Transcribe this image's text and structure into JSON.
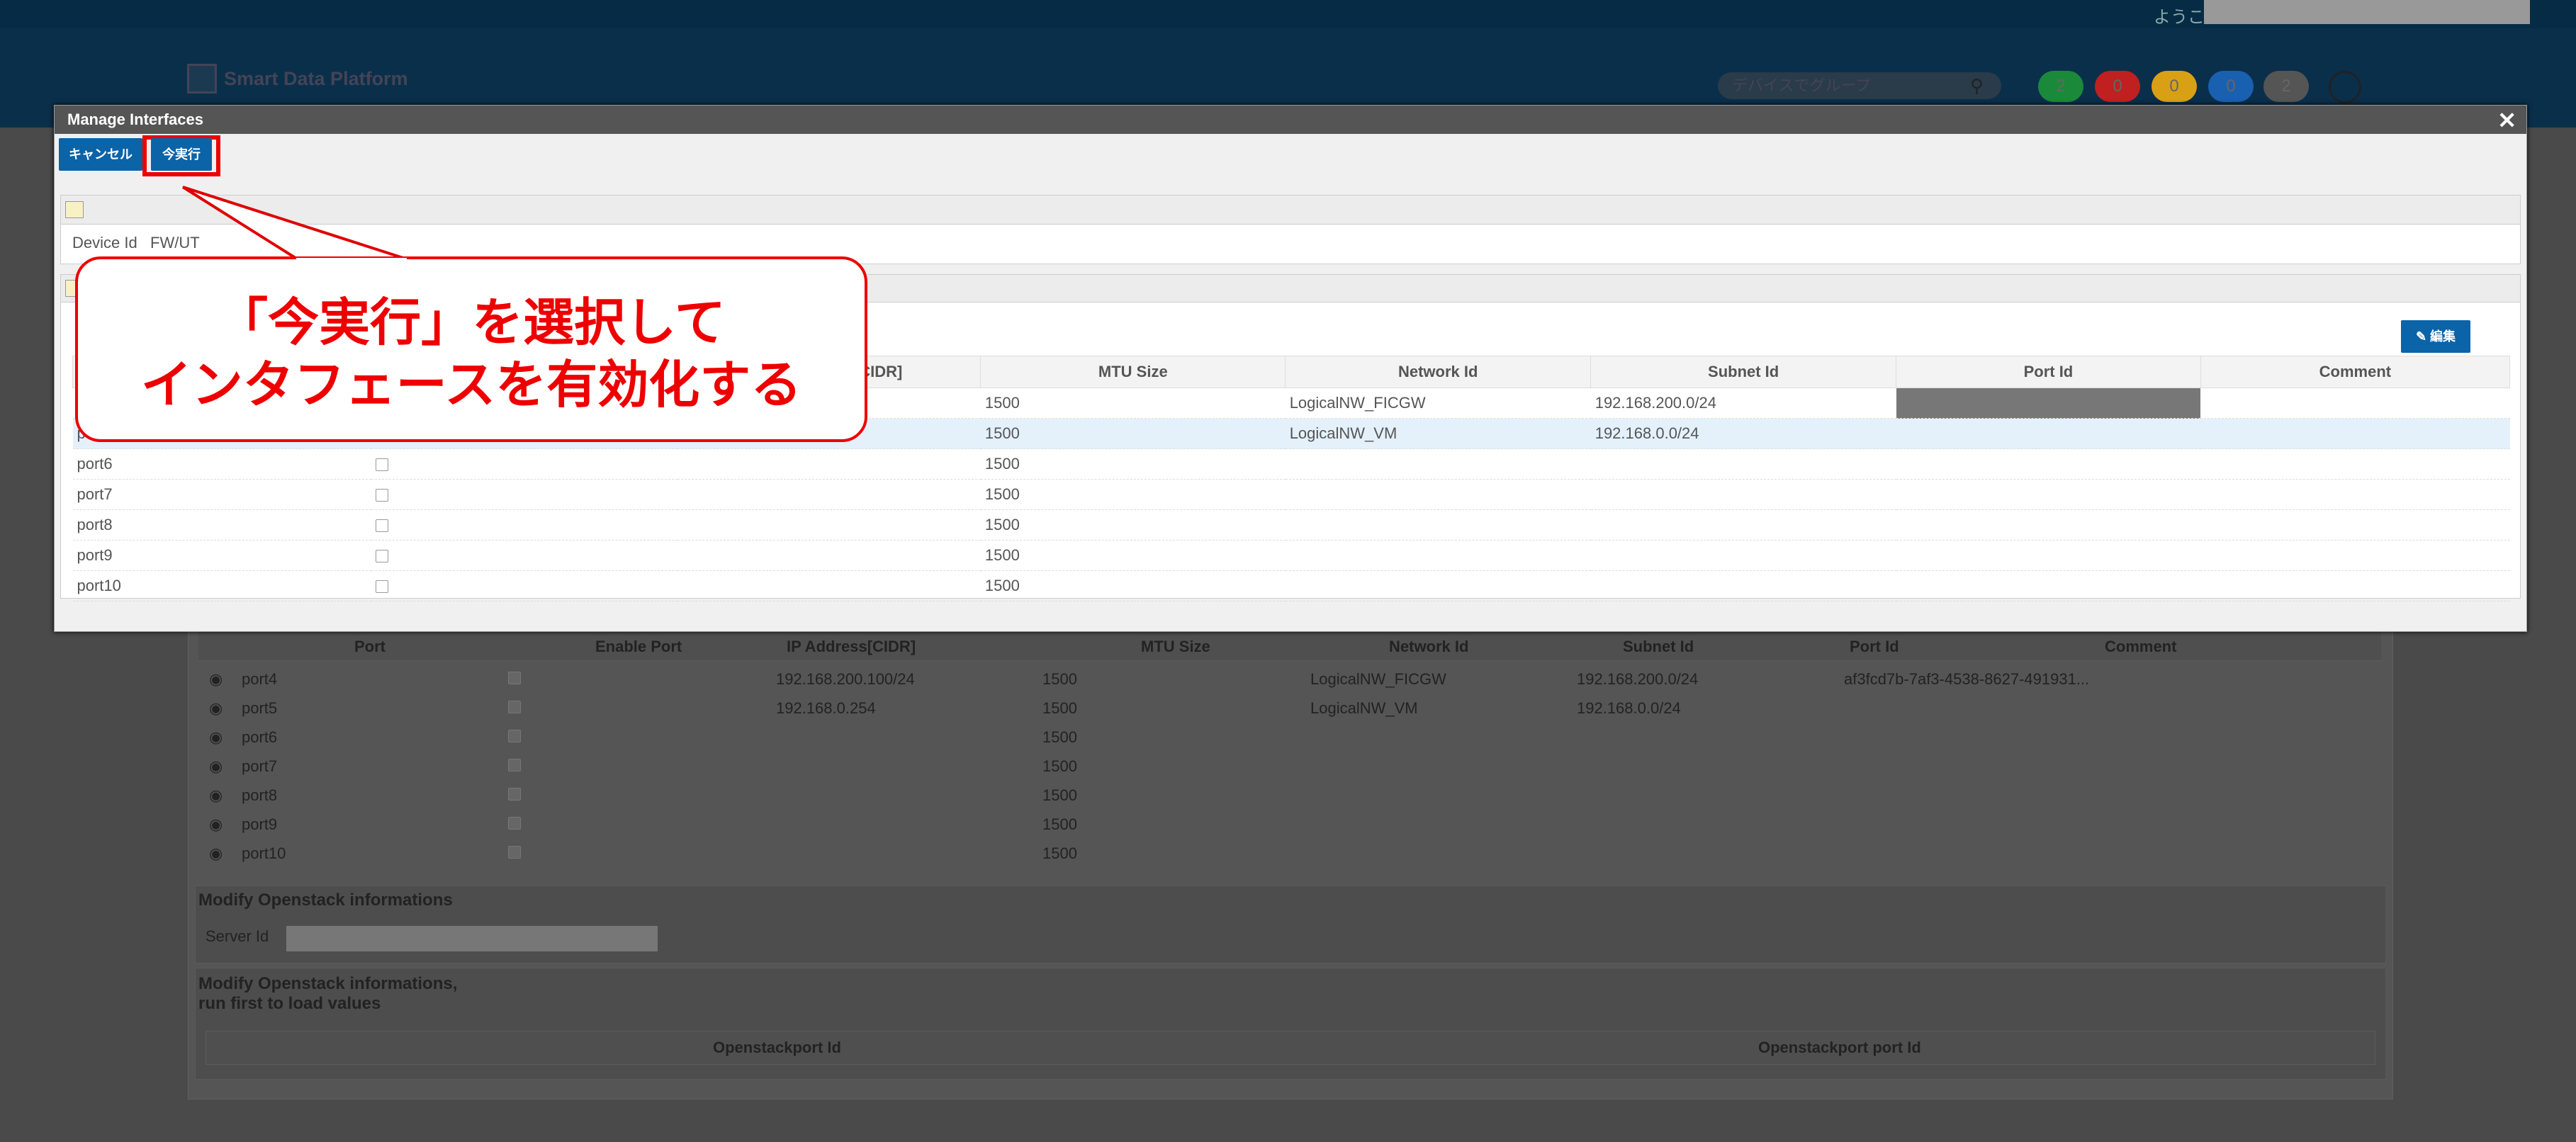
{
  "header": {
    "welcome": "ようこそ",
    "app_name": "Smart Data Platform",
    "search_placeholder": "デバイスでグループ",
    "badges": [
      {
        "value": "2",
        "color": "#1a8a3a"
      },
      {
        "value": "0",
        "color": "#c02020"
      },
      {
        "value": "0",
        "color": "#d9a016"
      },
      {
        "value": "0",
        "color": "#1a60b0"
      },
      {
        "value": "2",
        "color": "#555555"
      }
    ]
  },
  "background": {
    "columns": [
      "Port",
      "Enable Port",
      "IP Address[CIDR]",
      "MTU Size",
      "Network Id",
      "Subnet Id",
      "Port Id",
      "Comment"
    ],
    "rows": [
      {
        "port": "port4",
        "ip": "192.168.200.100/24",
        "mtu": "1500",
        "network": "LogicalNW_FICGW",
        "subnet": "192.168.200.0/24",
        "port_id": "af3fcd7b-7af3-4538-8627-491931..."
      },
      {
        "port": "port5",
        "ip": "192.168.0.254",
        "mtu": "1500",
        "network": "LogicalNW_VM",
        "subnet": "192.168.0.0/24",
        "port_id": ""
      },
      {
        "port": "port6",
        "ip": "",
        "mtu": "1500",
        "network": "",
        "subnet": "",
        "port_id": ""
      },
      {
        "port": "port7",
        "ip": "",
        "mtu": "1500",
        "network": "",
        "subnet": "",
        "port_id": ""
      },
      {
        "port": "port8",
        "ip": "",
        "mtu": "1500",
        "network": "",
        "subnet": "",
        "port_id": ""
      },
      {
        "port": "port9",
        "ip": "",
        "mtu": "1500",
        "network": "",
        "subnet": "",
        "port_id": ""
      },
      {
        "port": "port10",
        "ip": "",
        "mtu": "1500",
        "network": "",
        "subnet": "",
        "port_id": ""
      }
    ],
    "openstack_title": "Modify Openstack informations",
    "server_id_label": "Server Id",
    "openstack_title2_line1": "Modify Openstack informations,",
    "openstack_title2_line2": "run first to load values",
    "openstack_cols": [
      "Openstackport Id",
      "Openstackport port Id"
    ]
  },
  "modal": {
    "title": "Manage Interfaces",
    "cancel_label": "キャンセル",
    "execute_label": "今実行",
    "device_id_label": "Device Id",
    "device_id_value": "FW/UT",
    "edit_label": "編集",
    "columns": [
      "[CIDR]",
      "MTU Size",
      "Network Id",
      "Subnet Id",
      "Port Id",
      "Comment"
    ],
    "rows": [
      {
        "port": "",
        "mtu": "1500",
        "network": "LogicalNW_FICGW",
        "subnet": "192.168.200.0/24"
      },
      {
        "port": "p",
        "mtu": "1500",
        "network": "LogicalNW_VM",
        "subnet": "192.168.0.0/24"
      },
      {
        "port": "port6",
        "mtu": "1500",
        "network": "",
        "subnet": ""
      },
      {
        "port": "port7",
        "mtu": "1500",
        "network": "",
        "subnet": ""
      },
      {
        "port": "port8",
        "mtu": "1500",
        "network": "",
        "subnet": ""
      },
      {
        "port": "port9",
        "mtu": "1500",
        "network": "",
        "subnet": ""
      },
      {
        "port": "port10",
        "mtu": "1500",
        "network": "",
        "subnet": ""
      }
    ]
  },
  "callout": {
    "line1": "「今実行」を選択して",
    "line2": "インタフェースを有効化する",
    "color": "#e00000"
  }
}
